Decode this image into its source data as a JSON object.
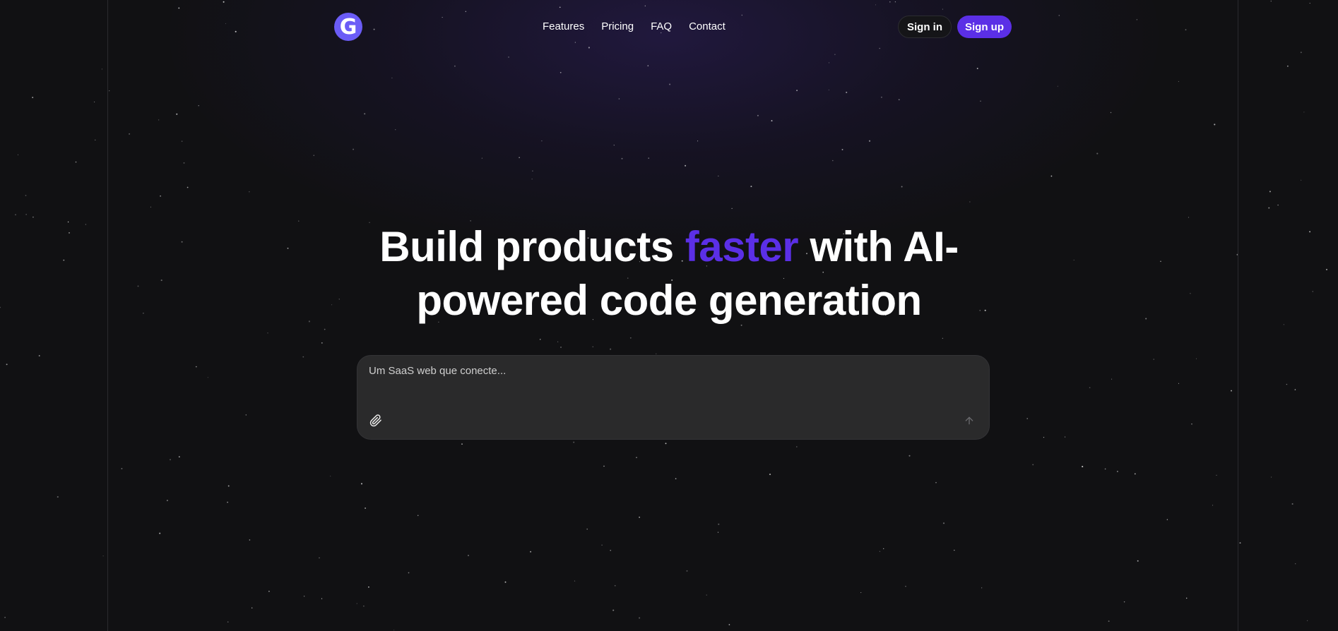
{
  "header": {
    "logo_letter": "G",
    "nav": [
      {
        "label": "Features"
      },
      {
        "label": "Pricing"
      },
      {
        "label": "FAQ"
      },
      {
        "label": "Contact"
      }
    ],
    "sign_in_label": "Sign in",
    "sign_up_label": "Sign up"
  },
  "hero": {
    "title_part1": "Build products ",
    "title_accent": "faster",
    "title_part2": " with AI-powered code generation"
  },
  "prompt": {
    "placeholder": "Um SaaS web que conecte...",
    "attach_icon": "paperclip-icon",
    "send_icon": "arrow-up-icon"
  },
  "colors": {
    "background": "#111113",
    "accent": "#5b2fe6",
    "logo": "#6b5cf6",
    "prompt_bg": "#2a2a2b"
  }
}
